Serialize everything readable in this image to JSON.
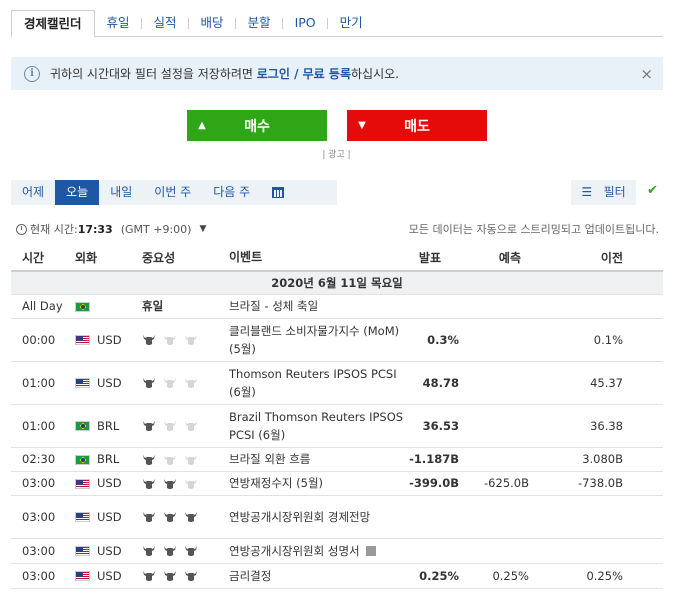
{
  "tabs": [
    {
      "label": "경제캘린더",
      "active": true
    },
    {
      "label": "휴일",
      "active": false
    },
    {
      "label": "실적",
      "active": false
    },
    {
      "label": "배당",
      "active": false
    },
    {
      "label": "분할",
      "active": false
    },
    {
      "label": "IPO",
      "active": false
    },
    {
      "label": "만기",
      "active": false
    }
  ],
  "banner": {
    "pre": "귀하의 시간대와 필터 설정을 저장하려면 ",
    "login": "로그인",
    "slash": " / ",
    "register": "무료 등록",
    "post": "하십시오.",
    "close": "×"
  },
  "buy_label": "매수",
  "sell_label": "매도",
  "ad_label": "| 광고 |",
  "datenav": [
    "어제",
    "오늘",
    "내일",
    "이번 주",
    "다음 주"
  ],
  "filter_label": "필터",
  "time": {
    "label": "현재 시간:",
    "value": "17:33",
    "tz": "(GMT +9:00)"
  },
  "stream_note": "모든 데이터는 자동으로 스트리밍되고 업데이트됩니다.",
  "headers": {
    "time": "시간",
    "currency": "외화",
    "importance": "중요성",
    "event": "이벤트",
    "actual": "발표",
    "forecast": "예측",
    "previous": "이전"
  },
  "day_label": "2020년 6월 11일 목요일",
  "colors": {
    "accent": "#1f57a5",
    "buy": "#2ea616",
    "sell": "#e60b0b"
  },
  "rows": [
    {
      "time": "All Day",
      "flag": "br",
      "currency": "",
      "holiday": "휴일",
      "bulls": 0,
      "event": "브라질 - 성체 축일",
      "actual": "",
      "actual_red": false,
      "forecast": "",
      "previous": "",
      "doc": false
    },
    {
      "time": "00:00",
      "flag": "us",
      "currency": "USD",
      "holiday": "",
      "bulls": 1,
      "event": "클리블랜드 소비자물가지수 (MoM) (5월)",
      "actual": "0.3%",
      "actual_red": false,
      "forecast": "",
      "previous": "0.1%",
      "doc": false
    },
    {
      "time": "01:00",
      "flag": "us",
      "currency": "USD",
      "holiday": "",
      "bulls": 1,
      "event": "Thomson Reuters IPSOS PCSI (6월)",
      "actual": "48.78",
      "actual_red": false,
      "forecast": "",
      "previous": "45.37",
      "doc": false
    },
    {
      "time": "01:00",
      "flag": "br",
      "currency": "BRL",
      "holiday": "",
      "bulls": 1,
      "event": "Brazil Thomson Reuters IPSOS PCSI (6월)",
      "actual": "36.53",
      "actual_red": false,
      "forecast": "",
      "previous": "36.38",
      "doc": false
    },
    {
      "time": "02:30",
      "flag": "br",
      "currency": "BRL",
      "holiday": "",
      "bulls": 1,
      "event": "브라질 외환 흐름",
      "actual": "-1.187B",
      "actual_red": false,
      "forecast": "",
      "previous": "3.080B",
      "doc": false
    },
    {
      "time": "03:00",
      "flag": "us",
      "currency": "USD",
      "holiday": "",
      "bulls": 2,
      "event": "연방재정수지 (5월)",
      "actual": "-399.0B",
      "actual_red": true,
      "forecast": "-625.0B",
      "previous": "-738.0B",
      "doc": false
    },
    {
      "time": "03:00",
      "flag": "us",
      "currency": "USD",
      "holiday": "",
      "bulls": 3,
      "event": "연방공개시장위원회 경제전망",
      "actual": "",
      "actual_red": false,
      "forecast": "",
      "previous": "",
      "doc": false
    },
    {
      "time": "03:00",
      "flag": "us",
      "currency": "USD",
      "holiday": "",
      "bulls": 3,
      "event": "연방공개시장위원회 성명서",
      "actual": "",
      "actual_red": false,
      "forecast": "",
      "previous": "",
      "doc": true
    },
    {
      "time": "03:00",
      "flag": "us",
      "currency": "USD",
      "holiday": "",
      "bulls": 3,
      "event": "금리결정",
      "actual": "0.25%",
      "actual_red": false,
      "forecast": "0.25%",
      "previous": "0.25%",
      "doc": false
    }
  ]
}
